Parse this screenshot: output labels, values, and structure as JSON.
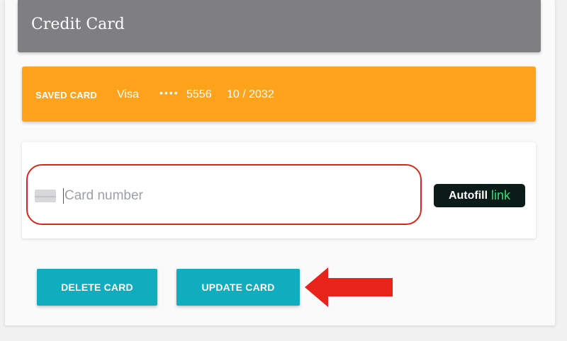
{
  "header": {
    "title": "Credit Card"
  },
  "saved_card": {
    "label": "SAVED CARD",
    "brand": "Visa",
    "masked_dots": "••••",
    "last4": "5556",
    "expiry": "10 / 2032"
  },
  "card_input": {
    "placeholder": "Card number",
    "value": ""
  },
  "autofill": {
    "text": "Autofill",
    "link_word": "link"
  },
  "buttons": {
    "delete": "DELETE CARD",
    "update": "UPDATE CARD"
  },
  "colors": {
    "header_bg": "#7f7e80",
    "saved_card_bg": "#fea31b",
    "button_bg": "#0fadbd",
    "highlight_outline": "#d9261c",
    "arrow": "#e8231a",
    "autofill_bg": "#0b1b17",
    "autofill_link": "#33dd7a"
  },
  "icons": [
    "card-icon",
    "arrow-left-icon"
  ]
}
